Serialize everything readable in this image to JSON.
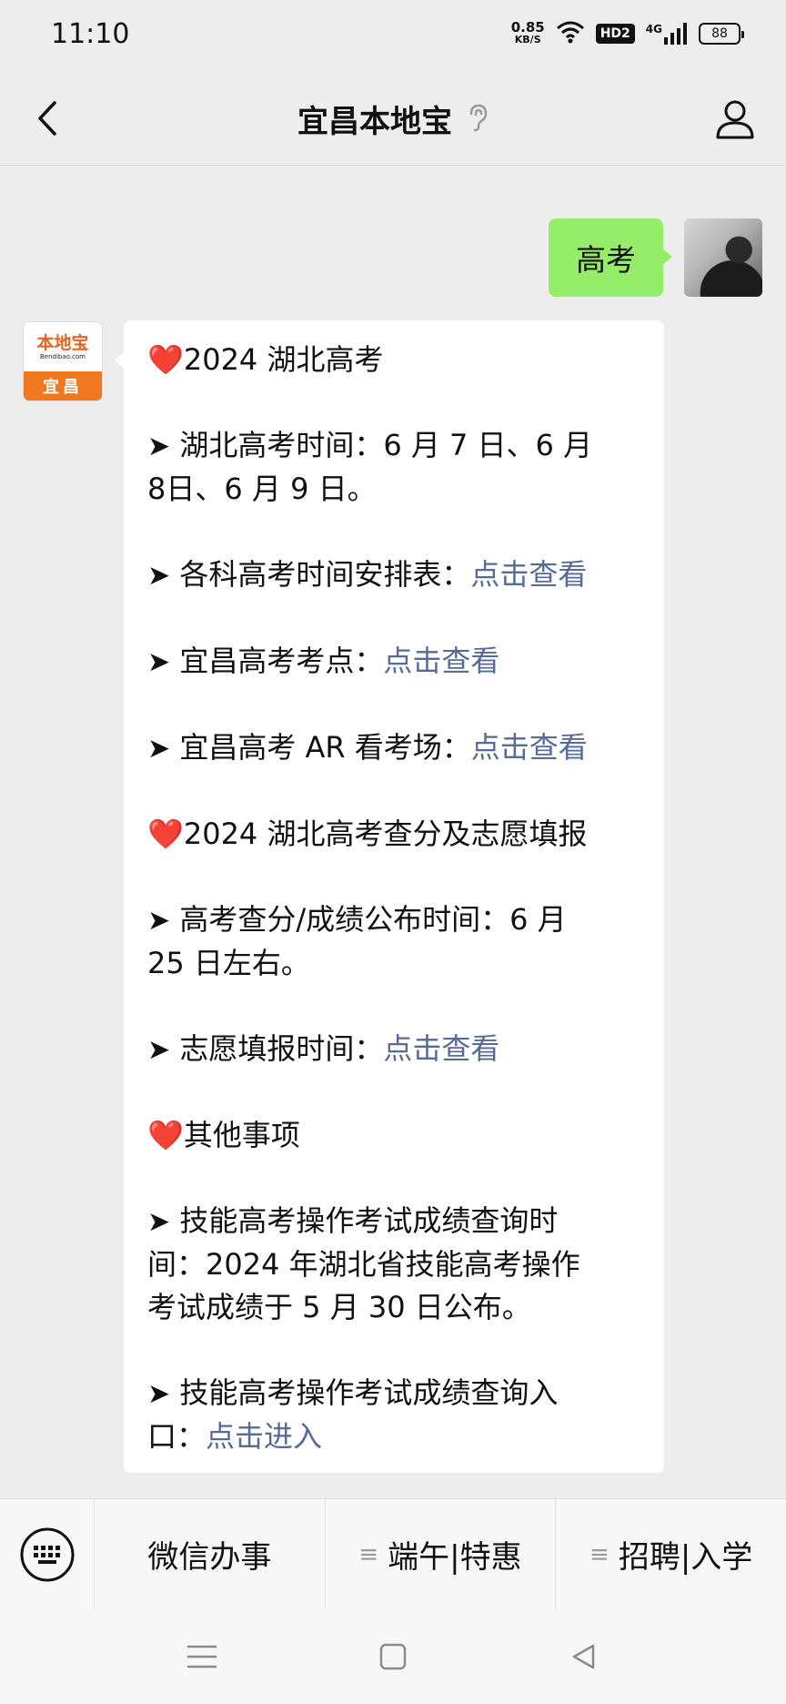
{
  "status_bar": {
    "time": "11:10",
    "net_speed": "0.85",
    "net_unit": "KB/S",
    "hd_badge": "HD2",
    "signal_label": "4G",
    "battery": "88"
  },
  "header": {
    "title": "宜昌本地宝"
  },
  "chat": {
    "user_message": "高考",
    "bot_avatar": {
      "logo_text": "本地宝",
      "logo_domain": "Bendibao.com",
      "city": "宜昌"
    },
    "bot_message": {
      "heart": "❤️",
      "arrow": "➤",
      "section1_title": "2024 湖北高考",
      "item1_line1": " 湖北高考时间：6 月 7 日、6 月",
      "item1_line2": "8日、6 月 9 日。",
      "item2_text": " 各科高考时间安排表：",
      "item2_link": "点击查看",
      "item3_text": " 宜昌高考考点：",
      "item3_link": "点击查看",
      "item4_text": " 宜昌高考 AR 看考场：",
      "item4_link": "点击查看",
      "section2_title": "2024 湖北高考查分及志愿填报",
      "item5_line1": " 高考查分/成绩公布时间：6 月",
      "item5_line2": "25 日左右。",
      "item6_text": " 志愿填报时间：",
      "item6_link": "点击查看",
      "section3_title": "其他事项",
      "item7_line1": " 技能高考操作考试成绩查询时",
      "item7_line2": "间：2024 年湖北省技能高考操作",
      "item7_line3": "考试成绩于 5 月 30 日公布。",
      "item8_line1": " 技能高考操作考试成绩查询入",
      "item8_line2": "口：",
      "item8_link": "点击进入"
    }
  },
  "menu": {
    "item1": "微信办事",
    "item2": "端午|特惠",
    "item3": "招聘|入学",
    "menu_icon": "≡"
  },
  "colors": {
    "background": "#ededed",
    "user_bubble": "#95ec69",
    "link": "#576b95",
    "brand_orange": "#f07821"
  }
}
